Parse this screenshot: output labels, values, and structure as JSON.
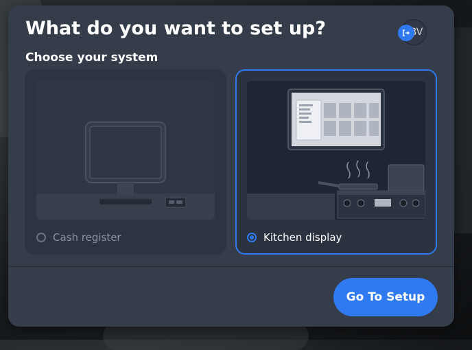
{
  "modal": {
    "title": "What do you want to set up?",
    "subtitle": "Choose your system"
  },
  "user": {
    "initials": "BV",
    "logout_icon": "logout-icon"
  },
  "options": [
    {
      "label": "Cash register",
      "selected": false,
      "icon": "cash-register-illustration"
    },
    {
      "label": "Kitchen display",
      "selected": true,
      "icon": "kitchen-display-illustration"
    }
  ],
  "footer": {
    "primary_button": "Go To Setup"
  },
  "colors": {
    "accent": "#2f7af0",
    "modal_bg": "#353d4b"
  }
}
